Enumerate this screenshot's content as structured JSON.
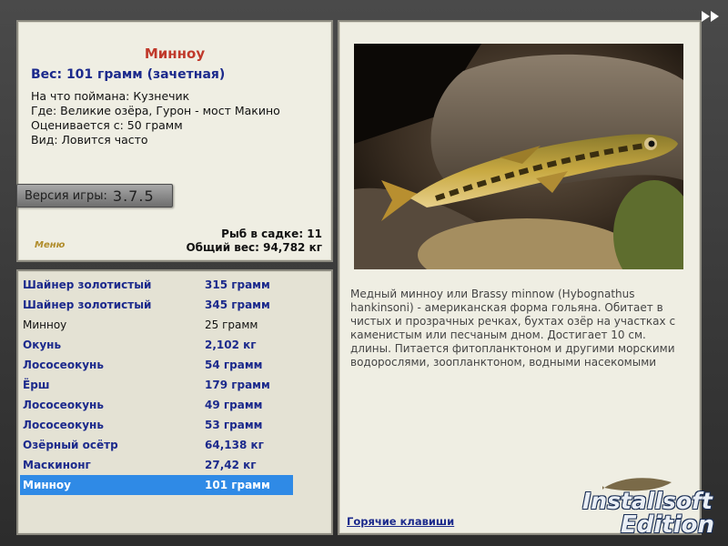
{
  "fish_info": {
    "name": "Минноу",
    "weight_line": "Вес: 101 грамм (зачетная)",
    "bait_line": "На что поймана: Кузнечик",
    "location_line": "Где: Великие озёра, Гурон - мост Макино",
    "value_line": "Оценивается с: 50 грамм",
    "frequency_line": "Вид: Ловится часто"
  },
  "version": {
    "label": "Версия игры:",
    "number": "3.7.5"
  },
  "menu_logo": "Меню",
  "keepnet": {
    "count_line": "Рыб в садке: 11",
    "total_line": "Общий вес: 94,782 кг"
  },
  "catch_list": [
    {
      "name": "Шайнер золотистый",
      "weight": "315 грамм",
      "style": "bold"
    },
    {
      "name": "Шайнер золотистый",
      "weight": "345 грамм",
      "style": "bold"
    },
    {
      "name": "Минноу",
      "weight": "25 грамм",
      "style": "plain"
    },
    {
      "name": "Окунь",
      "weight": "2,102 кг",
      "style": "bold"
    },
    {
      "name": "Лососеокунь",
      "weight": "54 грамм",
      "style": "bold"
    },
    {
      "name": "Ёрш",
      "weight": "179 грамм",
      "style": "bold"
    },
    {
      "name": "Лососеокунь",
      "weight": "49 грамм",
      "style": "bold"
    },
    {
      "name": "Лососеокунь",
      "weight": "53 грамм",
      "style": "bold"
    },
    {
      "name": "Озёрный осётр",
      "weight": "64,138 кг",
      "style": "bold"
    },
    {
      "name": "Маскинонг",
      "weight": "27,42 кг",
      "style": "bold"
    },
    {
      "name": "Минноу",
      "weight": "101 грамм",
      "style": "selected"
    }
  ],
  "description": "Медный минноу или Brassy minnow (Hybognathus hankinsoni) - американская форма гольяна. Обитает в чистых и прозрачных речках, бухтах озёр на участках с каменистым или песчаным дном. Достигает 10 см. длины. Питается фитопланктоном и другими морскими водорослями, зоопланктоном, водными насекомыми",
  "hotkeys_label": "Горячие клавиши",
  "icons": {
    "forward": "fast-forward-icon"
  },
  "watermark": {
    "line1": "Installsoft",
    "line2": "Edition"
  },
  "colors": {
    "accent_title": "#c0392b",
    "accent_blue": "#1c2a8c",
    "selection": "#2f8ae6"
  }
}
